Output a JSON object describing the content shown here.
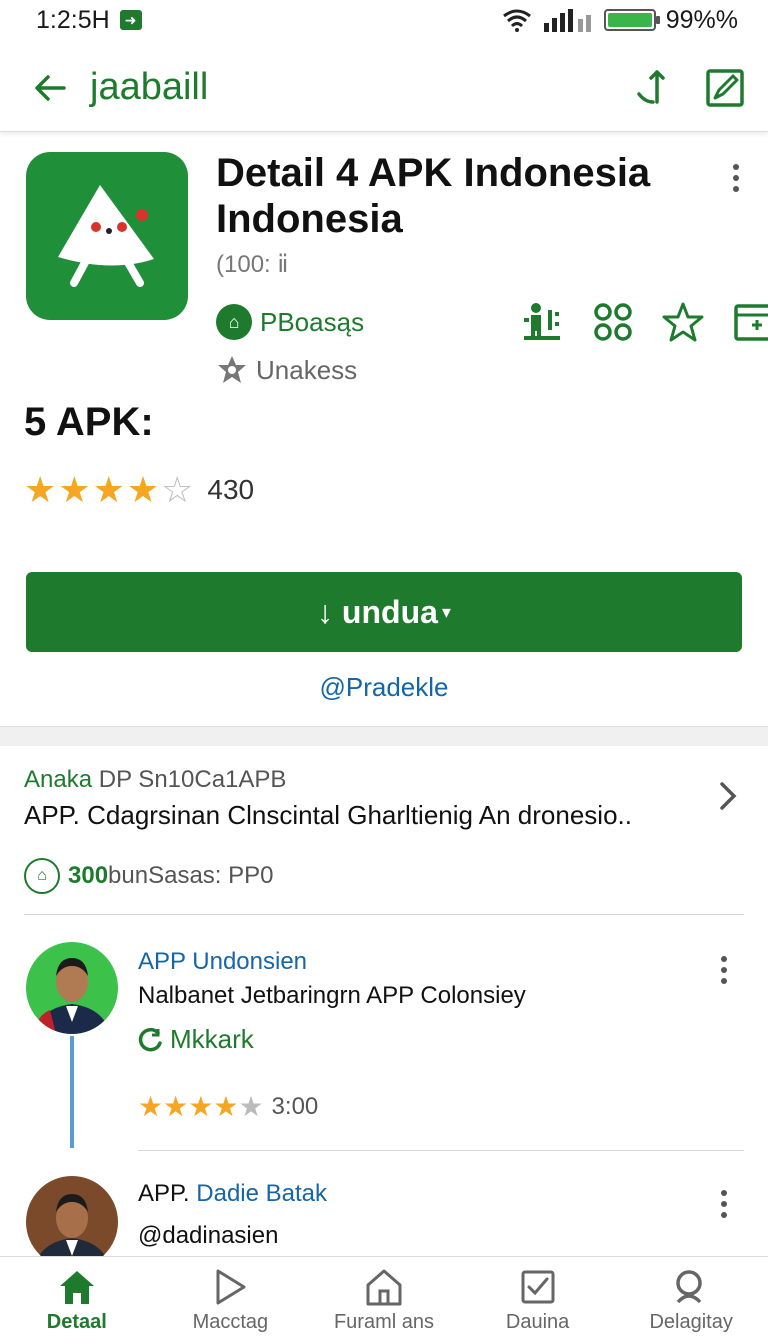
{
  "status_bar": {
    "time": "1:2:5H",
    "battery": "99%%"
  },
  "app_bar": {
    "title": "jaabaill"
  },
  "app": {
    "title_line1": "Detail 4 APK Indonesia",
    "title_line2": "Indonesia",
    "size": "(100: ⅱ",
    "publisher": "PBoasąs",
    "status": "Unakess"
  },
  "rating": {
    "title": "5 APK:",
    "count": "430",
    "value": 4.5
  },
  "install": {
    "label": "↓ undua",
    "arrow": "▾"
  },
  "secondary_link": "@Pradekle",
  "info": {
    "label_green": "Anaka",
    "label_rest": "DP Sn10Ca1APB",
    "description": "APP. Cdagrsinan Clnscintal Gharltienig An dronesio..",
    "downloads_num": "300",
    "downloads_rest": "bunSasas: PP0"
  },
  "reviews": [
    {
      "name": "APP Undonsien",
      "name_plain": "",
      "text": "Nalbanet Jetbaringrn APP Colonsiey",
      "tag": "Mkkark",
      "time": "3:00",
      "rating": 4.5
    },
    {
      "name": "Dadie Batak",
      "name_plain": "APP. ",
      "text": "@dadinasien"
    }
  ],
  "bottom_nav": [
    {
      "label": "Detaal",
      "icon": "home-icon",
      "active": true
    },
    {
      "label": "Macctag",
      "icon": "play-icon",
      "active": false
    },
    {
      "label": "Furaml ans",
      "icon": "house-outline-icon",
      "active": false
    },
    {
      "label": "Dauina",
      "icon": "checklist-icon",
      "active": false
    },
    {
      "label": "Delagitay",
      "icon": "search-icon",
      "active": false
    }
  ],
  "colors": {
    "primary": "#1e7b2e",
    "link": "#1565a9",
    "star": "#f5a623"
  }
}
